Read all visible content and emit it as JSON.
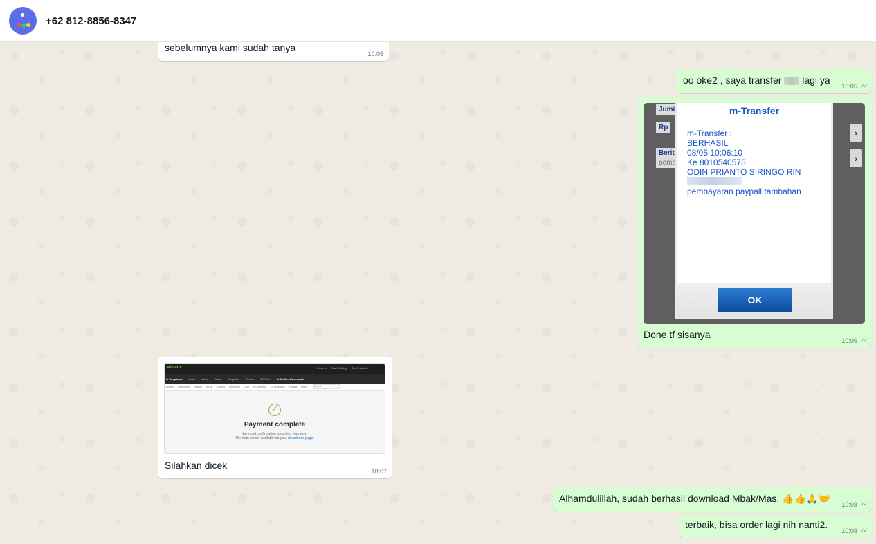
{
  "header": {
    "contact_name": "+62 812-8856-8347"
  },
  "colors": {
    "incoming_bubble": "#ffffff",
    "outgoing_bubble": "#d9fdd3",
    "chat_background": "#efeae2",
    "avatar": "#5b6ee8"
  },
  "messages": [
    {
      "direction": "in",
      "text": "sebelumnya kami sudah tanya",
      "time": "10:05"
    },
    {
      "direction": "out",
      "text_before": "oo oke2 , saya transfer",
      "text_after": "lagi ya",
      "time": "10:05"
    },
    {
      "direction": "out",
      "caption": "Done tf sisanya",
      "time": "10:06",
      "image": {
        "side_label_1": "Jumi",
        "side_label_2": "Rp",
        "side_label_3": "Berit",
        "side_label_3b": "pemb",
        "title": "m-Transfer",
        "lines": [
          "m-Transfer :",
          "BERHASIL",
          "08/05 10:06:10",
          "Ke 8010540578",
          "ODIN PRIANTO SIRINGO RIN"
        ],
        "note": "pembayaran paypall tambahan",
        "ok_label": "OK"
      }
    },
    {
      "direction": "in",
      "caption": "Silahkan dicek",
      "time": "10:07",
      "image": {
        "logo": "envato",
        "nav_right_1": "Forums",
        "nav_right_2": "Start Selling",
        "nav_right_3": "Our Products",
        "nav_items": [
          "& Templates",
          "Code",
          "Video",
          "Audio",
          "Graphics",
          "Photos",
          "3D Files",
          "Unlimited Downloads"
        ],
        "sub_items": [
          "Envato",
          "Commerce",
          "Hosting",
          "HTML",
          "Shopify",
          "Marketing",
          "CMS",
          "eCommerce",
          "UI Templates",
          "Plugins",
          "More"
        ],
        "search_placeholder": "Search",
        "title": "Payment complete",
        "line1": "An email confirmation is coming your way.",
        "line2": "The item is now available on your",
        "line2_link": "downloads page."
      }
    },
    {
      "direction": "out",
      "text": "Alhamdulillah, sudah berhasil download Mbak/Mas. 👍👍🙏🤝",
      "time": "10:08"
    },
    {
      "direction": "out",
      "text": "terbaik, bisa order lagi nih nanti2.",
      "time": "10:08"
    }
  ]
}
